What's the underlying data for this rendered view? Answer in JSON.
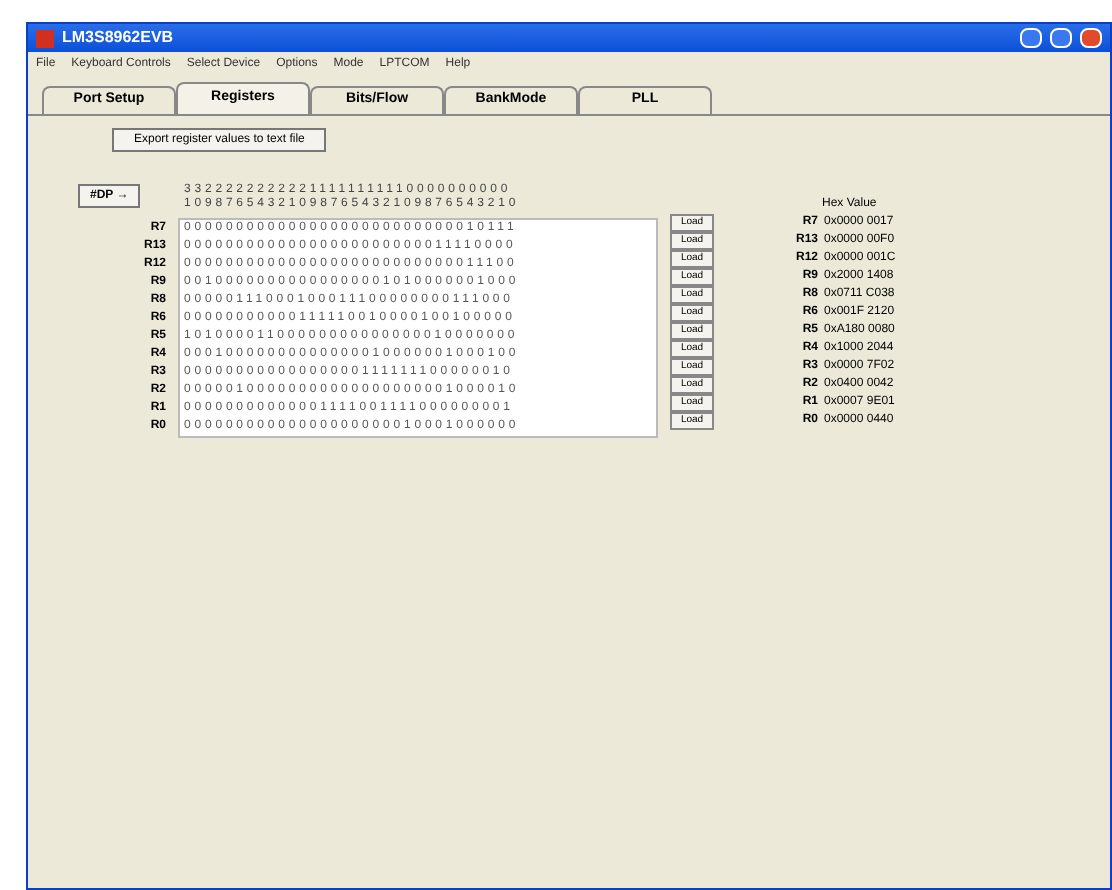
{
  "window": {
    "title": "LM3S8962EVB"
  },
  "menu": [
    "File",
    "Keyboard Controls",
    "Select Device",
    "Options",
    "Mode",
    "LPTCOM",
    "Help"
  ],
  "tabs": [
    {
      "label": "Port Setup",
      "selected": false
    },
    {
      "label": "Registers",
      "selected": true
    },
    {
      "label": "Bits/Flow",
      "selected": false
    },
    {
      "label": "BankMode",
      "selected": false
    },
    {
      "label": "PLL",
      "selected": false
    }
  ],
  "export_button": "Export register values to text file",
  "bit_button": "#DP →",
  "bit_header": [
    "33222222222211111111110000000000",
    "10987654321098765432109876543210"
  ],
  "hex_header": "Hex Value",
  "registers": [
    {
      "name": "R7",
      "bits": "00000000000000000000000000010111",
      "button": "Load",
      "hex_name": "R7",
      "hex": "0x0000 0017"
    },
    {
      "name": "R13",
      "bits": "00000000000000000000000011110000",
      "button": "Load",
      "hex_name": "R13",
      "hex": "0x0000 00F0"
    },
    {
      "name": "R12",
      "bits": "00000000000000000000000000011100",
      "button": "Load",
      "hex_name": "R12",
      "hex": "0x0000 001C"
    },
    {
      "name": "R9",
      "bits": "00100000000000000001010000001000",
      "button": "Load",
      "hex_name": "R9",
      "hex": "0x2000 1408"
    },
    {
      "name": "R8",
      "bits": "00000111000100011100000000111000",
      "button": "Load",
      "hex_name": "R8",
      "hex": "0x0711 C038"
    },
    {
      "name": "R6",
      "bits": "00000000000111110010000100100000",
      "button": "Load",
      "hex_name": "R6",
      "hex": "0x001F 2120"
    },
    {
      "name": "R5",
      "bits": "10100001100000000000000010000000",
      "button": "Load",
      "hex_name": "R5",
      "hex": "0xA180 0080"
    },
    {
      "name": "R4",
      "bits": "00010000000000000010000001000100",
      "button": "Load",
      "hex_name": "R4",
      "hex": "0x1000 2044"
    },
    {
      "name": "R3",
      "bits": "00000000000000000111111100000010",
      "button": "Load",
      "hex_name": "R3",
      "hex": "0x0000 7F02"
    },
    {
      "name": "R2",
      "bits": "00000100000000000000000001000010",
      "button": "Load",
      "hex_name": "R2",
      "hex": "0x0400 0042"
    },
    {
      "name": "R1",
      "bits": "00000000000001111001111000000001",
      "button": "Load",
      "hex_name": "R1",
      "hex": "0x0007 9E01"
    },
    {
      "name": "R0",
      "bits": "00000000000000000000010001000000",
      "button": "Load",
      "hex_name": "R0",
      "hex": "0x0000 0440"
    }
  ]
}
